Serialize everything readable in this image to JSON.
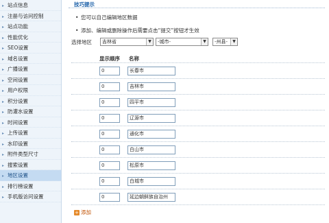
{
  "sidebar": {
    "items": [
      {
        "label": "站点信息",
        "active": false
      },
      {
        "label": "注册与访问控制",
        "active": false
      },
      {
        "label": "站点功能",
        "active": false
      },
      {
        "label": "性能优化",
        "active": false
      },
      {
        "label": "SEO设置",
        "active": false
      },
      {
        "label": "域名设置",
        "active": false
      },
      {
        "label": "广播设置",
        "active": false
      },
      {
        "label": "空间设置",
        "active": false
      },
      {
        "label": "用户权限",
        "active": false
      },
      {
        "label": "积分设置",
        "active": false
      },
      {
        "label": "防灌水设置",
        "active": false
      },
      {
        "label": "时间设置",
        "active": false
      },
      {
        "label": "上传设置",
        "active": false
      },
      {
        "label": "水印设置",
        "active": false
      },
      {
        "label": "附件类型尺寸",
        "active": false
      },
      {
        "label": "搜索设置",
        "active": false
      },
      {
        "label": "地区设置",
        "active": true
      },
      {
        "label": "排行榜设置",
        "active": false
      },
      {
        "label": "手机版访问设置",
        "active": false
      }
    ]
  },
  "tips": {
    "title": "技巧提示",
    "lines": [
      "您可以自己编辑地区数据",
      "添加、编辑或删除操作后需要点击“提交”按钮才生效"
    ]
  },
  "region": {
    "label": "选择地区",
    "province": "吉林省",
    "city": "-城市-",
    "county": "-州县-"
  },
  "table": {
    "col_order": "显示顺序",
    "col_name": "名称",
    "rows": [
      {
        "order": "0",
        "name": "长春市"
      },
      {
        "order": "0",
        "name": "吉林市"
      },
      {
        "order": "0",
        "name": "四平市"
      },
      {
        "order": "0",
        "name": "辽源市"
      },
      {
        "order": "0",
        "name": "通化市"
      },
      {
        "order": "0",
        "name": "白山市"
      },
      {
        "order": "0",
        "name": "松原市"
      },
      {
        "order": "0",
        "name": "白城市"
      },
      {
        "order": "0",
        "name": "延边朝鲜族自治州"
      }
    ]
  },
  "add_label": "添加",
  "colors": {
    "accent": "#1a5fa8",
    "sidebar_bg": "#eef4fa",
    "active_bg": "#c4dbf2",
    "add": "#c05000"
  }
}
